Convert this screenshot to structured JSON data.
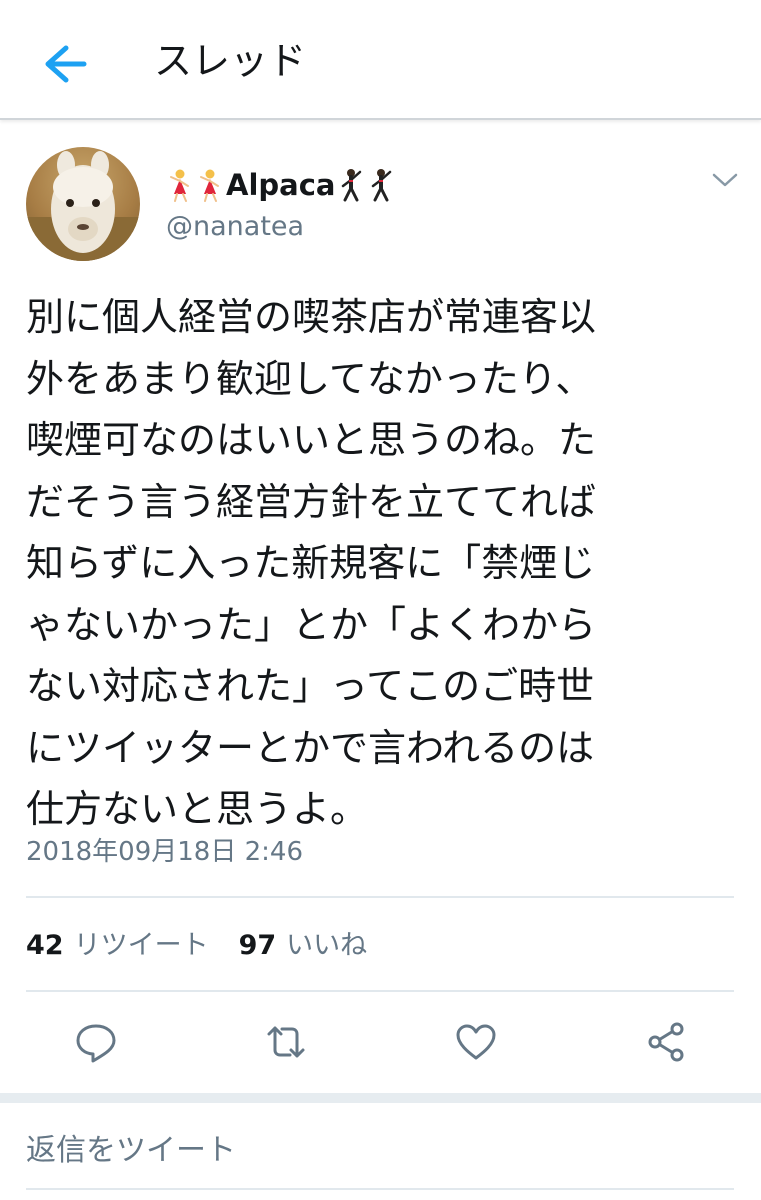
{
  "header": {
    "title": "スレッド",
    "back_icon": "arrow-left-icon"
  },
  "tweet": {
    "display_name": "Alpaca",
    "handle": "@nanatea",
    "name_emojis_before": [
      "dancer-emoji",
      "dancer-emoji"
    ],
    "name_emojis_after": [
      "man-dancing-emoji",
      "man-dancing-emoji"
    ],
    "text": "別に個人経営の喫茶店が常連客以\n外をあまり歓迎してなかったり、\n喫煙可なのはいいと思うのね。た\nだそう言う経営方針を立ててれば\n知らずに入った新規客に「禁煙じ\nゃないかった」とか「よくわから\nない対応された」ってこのご時世\nにツイッターとかで言われるのは\n仕方ないと思うよ。",
    "timestamp": "2018年09月18日 2:46"
  },
  "stats": {
    "retweets_count": "42",
    "retweets_label": "リツイート",
    "likes_count": "97",
    "likes_label": "いいね"
  },
  "actions": [
    "reply-icon",
    "retweet-icon",
    "like-icon",
    "share-icon"
  ],
  "reply": {
    "placeholder": "返信をツイート"
  },
  "colors": {
    "accent": "#1da1f2",
    "secondary_text": "#657786",
    "divider": "#e1e8ed",
    "icon": "#657786"
  }
}
